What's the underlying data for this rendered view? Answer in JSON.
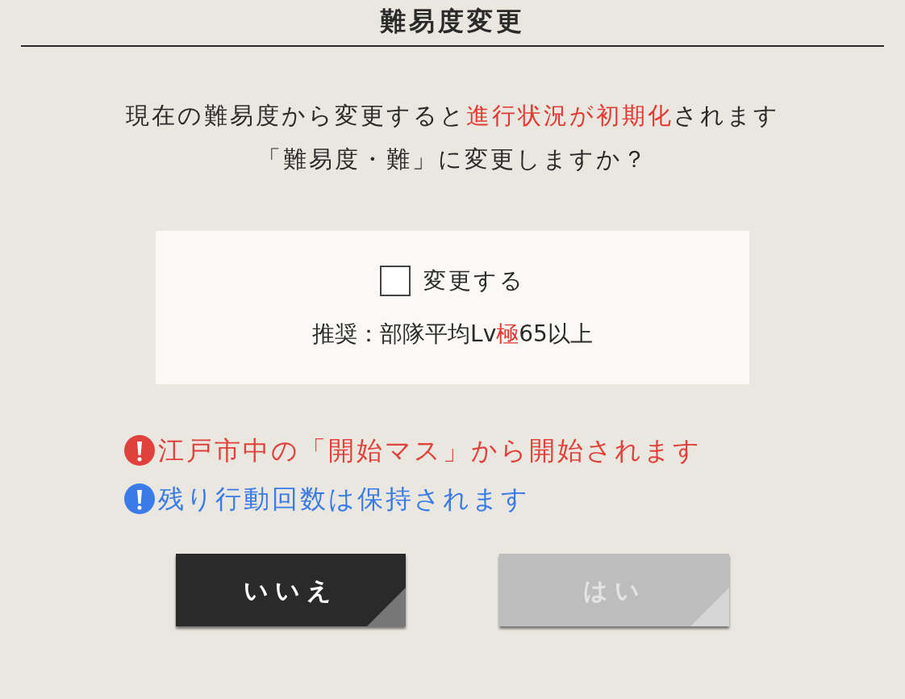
{
  "dialog": {
    "title": "難易度変更",
    "message": [
      [
        {
          "text": "現在の難易度から変更すると",
          "highlight": false
        },
        {
          "text": "進行状況が初期化",
          "highlight": true
        },
        {
          "text": "されます",
          "highlight": false
        }
      ],
      [
        {
          "text": "「難易度・難」に変更しますか？",
          "highlight": false
        }
      ]
    ],
    "confirm_box": {
      "checkbox": {
        "label": "変更する",
        "checked": false
      },
      "recommendation": [
        {
          "text": "推奨：部隊平均Lv",
          "highlight": false
        },
        {
          "text": "極",
          "highlight": true
        },
        {
          "text": "65以上",
          "highlight": false
        }
      ]
    },
    "notices": [
      {
        "text": "江戸市中の「開始マス」から開始されます",
        "color": "#e0413a"
      },
      {
        "text": "残り行動回数は保持されます",
        "color": "#3a7be8"
      }
    ],
    "buttons": [
      {
        "label": "いいえ",
        "disabled": false
      },
      {
        "label": "はい",
        "disabled": true
      }
    ]
  }
}
